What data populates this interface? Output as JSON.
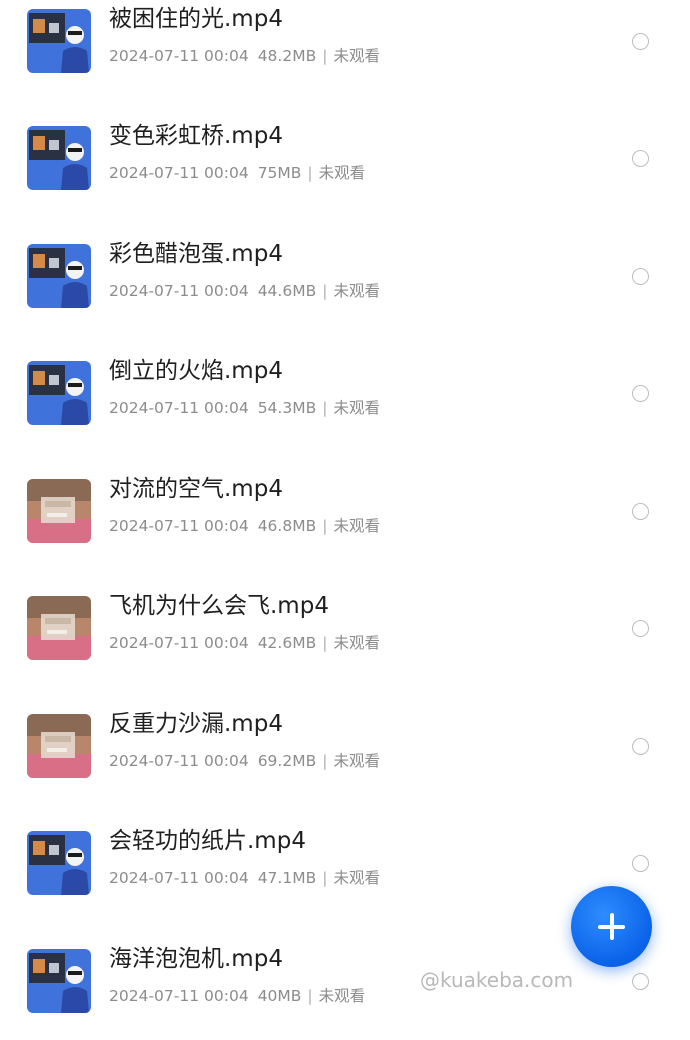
{
  "colors": {
    "accent": "#0a63e8",
    "title_text": "#1f1f1f",
    "meta_text": "#8c8c8c",
    "radio_border": "#bdbdbd"
  },
  "videos": [
    {
      "title": "被困住的光.mp4",
      "datetime": "2024-07-11 00:04",
      "size": "48.2MB",
      "status": "未观看",
      "thumb_style": "blue"
    },
    {
      "title": "变色彩虹桥.mp4",
      "datetime": "2024-07-11 00:04",
      "size": "75MB",
      "status": "未观看",
      "thumb_style": "blue"
    },
    {
      "title": "彩色醋泡蛋.mp4",
      "datetime": "2024-07-11 00:04",
      "size": "44.6MB",
      "status": "未观看",
      "thumb_style": "blue"
    },
    {
      "title": "倒立的火焰.mp4",
      "datetime": "2024-07-11 00:04",
      "size": "54.3MB",
      "status": "未观看",
      "thumb_style": "blue"
    },
    {
      "title": "对流的空气.mp4",
      "datetime": "2024-07-11 00:04",
      "size": "46.8MB",
      "status": "未观看",
      "thumb_style": "pink"
    },
    {
      "title": "飞机为什么会飞.mp4",
      "datetime": "2024-07-11 00:04",
      "size": "42.6MB",
      "status": "未观看",
      "thumb_style": "pink"
    },
    {
      "title": "反重力沙漏.mp4",
      "datetime": "2024-07-11 00:04",
      "size": "69.2MB",
      "status": "未观看",
      "thumb_style": "pink"
    },
    {
      "title": "会轻功的纸片.mp4",
      "datetime": "2024-07-11 00:04",
      "size": "47.1MB",
      "status": "未观看",
      "thumb_style": "blue"
    },
    {
      "title": "海洋泡泡机.mp4",
      "datetime": "2024-07-11 00:04",
      "size": "40MB",
      "status": "未观看",
      "thumb_style": "blue"
    }
  ],
  "fab": {
    "icon": "plus-icon"
  },
  "watermark": {
    "text": "@kuakeba.com"
  }
}
